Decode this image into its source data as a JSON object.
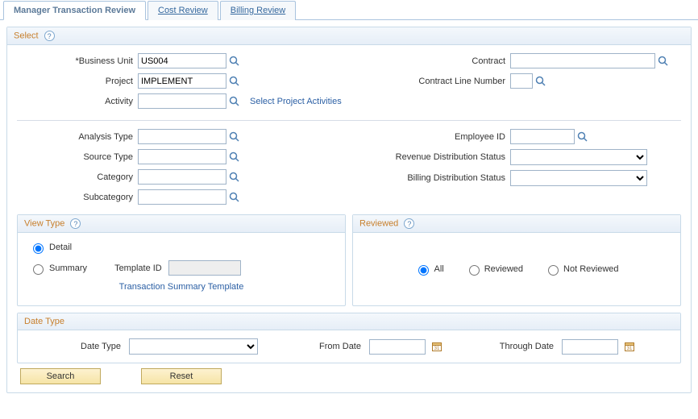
{
  "tabs": {
    "manager": "Manager Transaction Review",
    "cost": "Cost Review",
    "billing": "Billing Review"
  },
  "select_section": {
    "title": "Select",
    "labels": {
      "business_unit": "*Business Unit",
      "project": "Project",
      "activity": "Activity",
      "contract": "Contract",
      "contract_line_number": "Contract Line Number",
      "analysis_type": "Analysis Type",
      "source_type": "Source Type",
      "category": "Category",
      "subcategory": "Subcategory",
      "employee_id": "Employee ID",
      "revenue_dist_status": "Revenue Distribution Status",
      "billing_dist_status": "Billing Distribution Status"
    },
    "values": {
      "business_unit": "US004",
      "project": "IMPLEMENT",
      "activity": "",
      "contract": "",
      "contract_line_number": "",
      "analysis_type": "",
      "source_type": "",
      "category": "",
      "subcategory": "",
      "employee_id": "",
      "revenue_dist_status": "",
      "billing_dist_status": ""
    },
    "links": {
      "select_activities": "Select Project Activities"
    }
  },
  "view_type": {
    "title": "View Type",
    "detail": "Detail",
    "summary": "Summary",
    "template_id_label": "Template ID",
    "template_id_value": "",
    "summary_link": "Transaction Summary Template"
  },
  "reviewed": {
    "title": "Reviewed",
    "all": "All",
    "reviewed": "Reviewed",
    "not_reviewed": "Not Reviewed"
  },
  "date_type": {
    "title": "Date Type",
    "label": "Date Type",
    "value": "",
    "from_label": "From Date",
    "from_value": "",
    "through_label": "Through Date",
    "through_value": ""
  },
  "buttons": {
    "search": "Search",
    "reset": "Reset"
  }
}
